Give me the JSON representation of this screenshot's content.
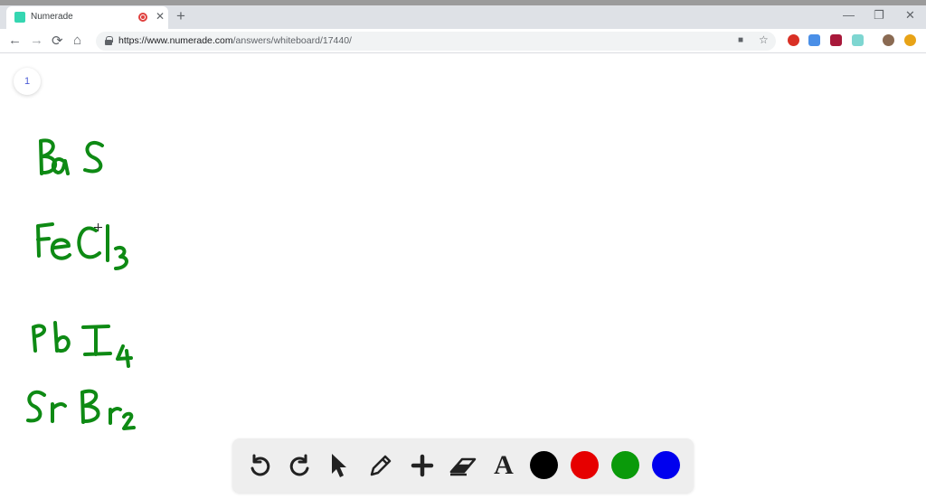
{
  "browser": {
    "tab_title": "Numerade",
    "tab_close": "✕",
    "new_tab": "+",
    "url_host": "https://www.numerade.com",
    "url_path": "/answers/whiteboard/17440/",
    "window_controls": {
      "minimize": "—",
      "restore": "❐",
      "close": "✕"
    },
    "nav": {
      "back": "←",
      "forward": "→",
      "reload": "⟳",
      "home": "⌂"
    }
  },
  "whiteboard": {
    "page_number": "1",
    "formulas": [
      {
        "main": "BaS",
        "subscript": ""
      },
      {
        "main": "FeCl",
        "subscript": "3"
      },
      {
        "main": "PbI",
        "subscript": "4"
      },
      {
        "main": "SrBr",
        "subscript": "2"
      }
    ],
    "ink_color": "#0e8a14"
  },
  "toolbar": {
    "tools": [
      "undo-icon",
      "redo-icon",
      "pointer-icon",
      "pencil-icon",
      "plus-icon",
      "eraser-icon",
      "text-icon"
    ],
    "text_tool_label": "A",
    "colors": [
      "#000000",
      "#e60000",
      "#0a9a0a",
      "#0000ee"
    ]
  }
}
